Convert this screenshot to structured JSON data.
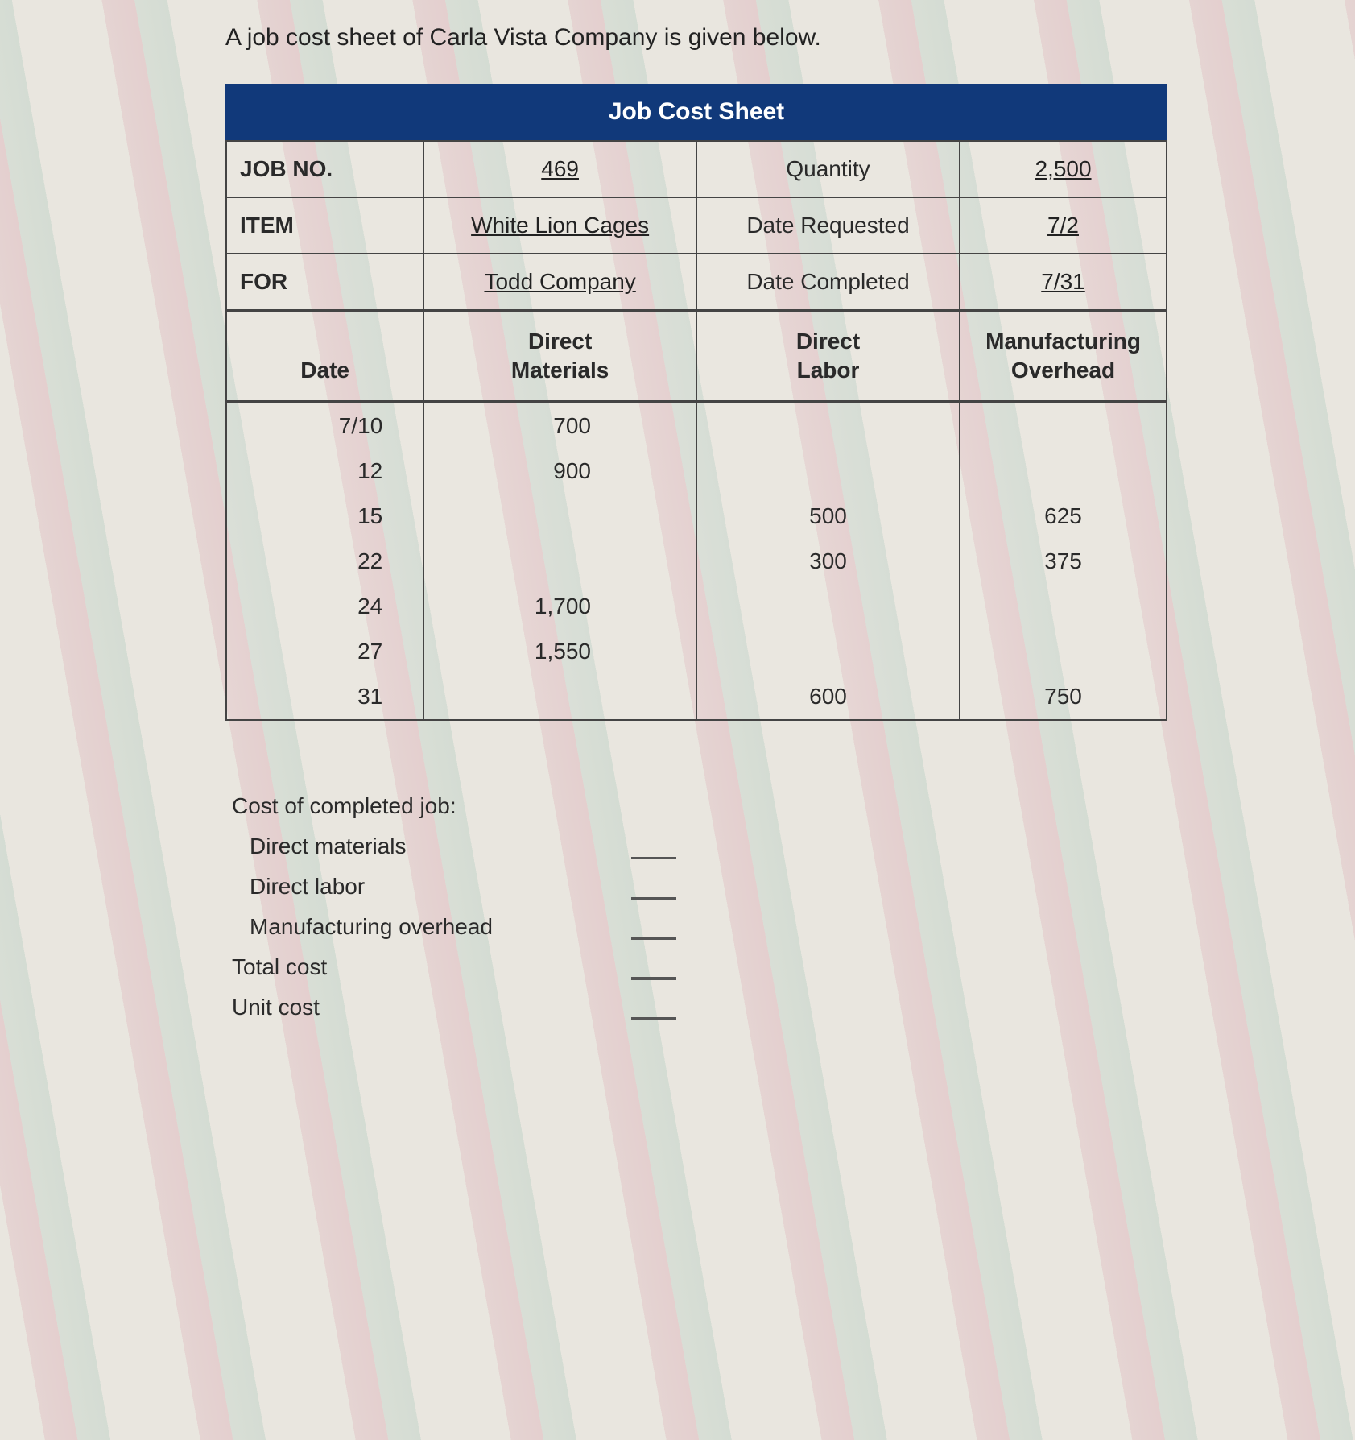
{
  "intro": "A job cost sheet of Carla Vista Company is given below.",
  "title": "Job Cost Sheet",
  "header": {
    "jobno_label": "JOB NO.",
    "jobno_value": "469",
    "quantity_label": "Quantity",
    "quantity_value": "2,500",
    "item_label": "ITEM",
    "item_value": "White Lion Cages",
    "date_requested_label": "Date Requested",
    "date_requested_value": "7/2",
    "for_label": "FOR",
    "for_value": "Todd Company",
    "date_completed_label": "Date Completed",
    "date_completed_value": "7/31"
  },
  "columns": {
    "date": "Date",
    "dm1": "Direct",
    "dm2": "Materials",
    "dl1": "Direct",
    "dl2": "Labor",
    "oh1": "Manufacturing",
    "oh2": "Overhead"
  },
  "rows": [
    {
      "date": "7/10",
      "dm": "700",
      "dl": "",
      "oh": ""
    },
    {
      "date": "12",
      "dm": "900",
      "dl": "",
      "oh": ""
    },
    {
      "date": "15",
      "dm": "",
      "dl": "500",
      "oh": "625"
    },
    {
      "date": "22",
      "dm": "",
      "dl": "300",
      "oh": "375"
    },
    {
      "date": "24",
      "dm": "1,700",
      "dl": "",
      "oh": ""
    },
    {
      "date": "27",
      "dm": "1,550",
      "dl": "",
      "oh": ""
    },
    {
      "date": "31",
      "dm": "",
      "dl": "600",
      "oh": "750"
    }
  ],
  "completed": {
    "heading": "Cost of completed job:",
    "direct_materials": "Direct materials",
    "direct_labor": "Direct labor",
    "manufacturing_overhead": "Manufacturing overhead",
    "total_cost": "Total cost",
    "unit_cost": "Unit cost"
  }
}
